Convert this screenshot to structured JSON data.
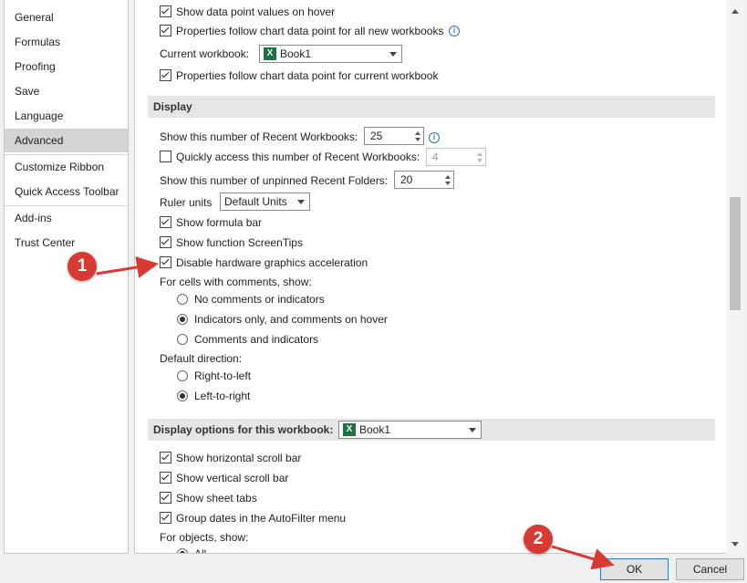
{
  "sidebar": {
    "items": [
      {
        "label": "General"
      },
      {
        "label": "Formulas"
      },
      {
        "label": "Proofing"
      },
      {
        "label": "Save"
      },
      {
        "label": "Language"
      },
      {
        "label": "Advanced",
        "active": true
      },
      {
        "label": "Customize Ribbon"
      },
      {
        "label": "Quick Access Toolbar"
      },
      {
        "label": "Add-ins"
      },
      {
        "label": "Trust Center"
      }
    ]
  },
  "chart_section": {
    "show_values_hover": {
      "label": "Show data point values on hover",
      "checked": true
    },
    "properties_all_new": {
      "label": "Properties follow chart data point for all new workbooks",
      "checked": true
    },
    "current_workbook_label": "Current workbook:",
    "current_workbook_value": "Book1",
    "properties_current": {
      "label": "Properties follow chart data point for current workbook",
      "checked": true
    }
  },
  "display": {
    "header": "Display",
    "recent_workbooks_label": "Show this number of Recent Workbooks:",
    "recent_workbooks_value": "25",
    "quick_access": {
      "label": "Quickly access this number of Recent Workbooks:",
      "checked": false
    },
    "quick_access_value": "4",
    "unpinned_folders_label": "Show this number of unpinned Recent Folders:",
    "unpinned_folders_value": "20",
    "ruler_units_label": "Ruler units",
    "ruler_units_value": "Default Units",
    "formula_bar": {
      "label": "Show formula bar",
      "checked": true
    },
    "screentips": {
      "label": "Show function ScreenTips",
      "checked": true
    },
    "hw_accel": {
      "label": "Disable hardware graphics acceleration",
      "checked": true
    },
    "comments_label": "For cells with comments, show:",
    "comments_options": [
      {
        "label": "No comments or indicators",
        "checked": false
      },
      {
        "label": "Indicators only, and comments on hover",
        "checked": true
      },
      {
        "label": "Comments and indicators",
        "checked": false
      }
    ],
    "direction_label": "Default direction:",
    "direction_options": [
      {
        "label": "Right-to-left",
        "checked": false
      },
      {
        "label": "Left-to-right",
        "checked": true
      }
    ]
  },
  "workbook_display": {
    "header": "Display options for this workbook:",
    "workbook_value": "Book1",
    "horiz_scroll": {
      "label": "Show horizontal scroll bar",
      "checked": true
    },
    "vert_scroll": {
      "label": "Show vertical scroll bar",
      "checked": true
    },
    "sheet_tabs": {
      "label": "Show sheet tabs",
      "checked": true
    },
    "group_dates": {
      "label": "Group dates in the AutoFilter menu",
      "checked": true
    },
    "objects_label": "For objects, show:",
    "objects_first": "All"
  },
  "buttons": {
    "ok": "OK",
    "cancel": "Cancel"
  },
  "callouts": [
    "1",
    "2"
  ],
  "colors": {
    "callout": "#d63a32",
    "active_nav": "#d4d4d4",
    "excel_green": "#1e7145"
  }
}
